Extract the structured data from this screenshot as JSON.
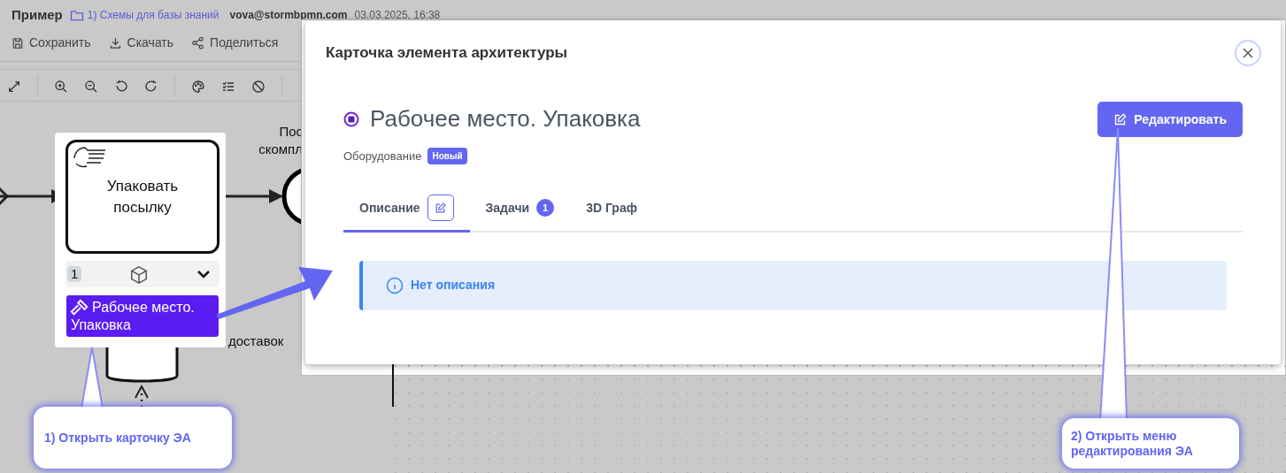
{
  "header": {
    "title": "Пример",
    "folder": "1) Схемы для базы знаний",
    "user": "vova@stormbpmn.com",
    "date": "03.03.2025, 16:38"
  },
  "actions": [
    {
      "kind": "save",
      "label": "Сохранить"
    },
    {
      "kind": "download",
      "label": "Скачать"
    },
    {
      "kind": "share",
      "label": "Поделиться"
    }
  ],
  "diagram": {
    "task": "Упаковать посылку",
    "count": "1",
    "element": "Рабочее место. Упаковка",
    "event_label": [
      "Пос",
      "скомпл"
    ],
    "store_label": "доставок"
  },
  "modal": {
    "title": "Карточка элемента архитектуры",
    "name": "Рабочее место. Упаковка",
    "type": "Оборудование",
    "badge": "Новый",
    "edit_button": "Редактировать",
    "tabs": [
      {
        "label": "Описание",
        "selected": true,
        "kind": "edit"
      },
      {
        "label": "Задачи",
        "selected": false,
        "kind": "count",
        "count": "1"
      },
      {
        "label": "3D Граф",
        "selected": false,
        "kind": "plain"
      }
    ],
    "alert": "Нет описания"
  },
  "callouts": [
    {
      "text": "1) Открыть карточку ЭА"
    },
    {
      "text": "2) Открыть меню редактирования ЭА"
    }
  ]
}
